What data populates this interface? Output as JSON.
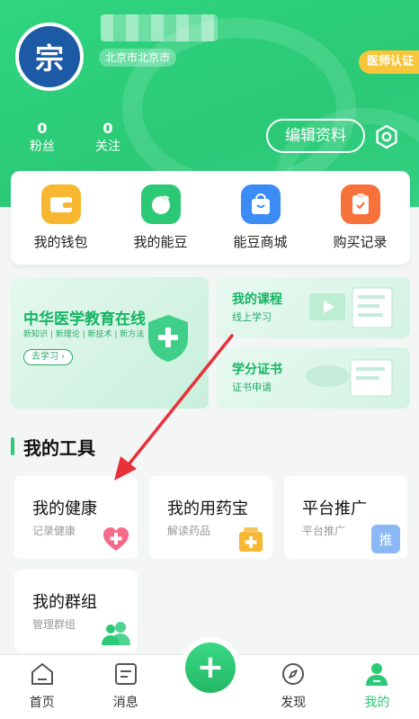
{
  "profile": {
    "location": "北京市北京市",
    "cert_badge": "医师认证",
    "avatar_glyph": "宗",
    "fans_count": "0",
    "fans_label": "粉丝",
    "follow_count": "0",
    "follow_label": "关注",
    "edit_label": "编辑资料"
  },
  "wallet": [
    {
      "label": "我的钱包",
      "icon": "wallet-icon",
      "color": "#f7b731"
    },
    {
      "label": "我的能豆",
      "icon": "bean-icon",
      "color": "#2bc976"
    },
    {
      "label": "能豆商城",
      "icon": "shopping-bag-icon",
      "color": "#3b8cf5"
    },
    {
      "label": "购买记录",
      "icon": "clipboard-icon",
      "color": "#f7723b"
    }
  ],
  "banners": {
    "big": {
      "title": "中华医学教育在线",
      "subtitle": "新知识 | 新理论 | 新技术 | 新方法",
      "button": "去学习 ›"
    },
    "course": {
      "title": "我的课程",
      "subtitle": "线上学习"
    },
    "credit": {
      "title": "学分证书",
      "subtitle": "证书申请"
    }
  },
  "tools": {
    "section_title": "我的工具",
    "items": [
      {
        "title": "我的健康",
        "subtitle": "记录健康",
        "icon": "heart-plus-icon"
      },
      {
        "title": "我的用药宝",
        "subtitle": "解读药品",
        "icon": "medicine-box-icon"
      },
      {
        "title": "平台推广",
        "subtitle": "平台推广",
        "icon": "promote-icon",
        "icon_text": "推"
      },
      {
        "title": "我的群组",
        "subtitle": "管理群组",
        "icon": "group-icon"
      }
    ]
  },
  "tabbar": {
    "items": [
      {
        "label": "首页",
        "icon": "home-icon"
      },
      {
        "label": "消息",
        "icon": "message-icon"
      },
      {
        "label": "发现",
        "icon": "compass-icon"
      },
      {
        "label": "我的",
        "icon": "profile-icon",
        "active": true
      }
    ],
    "fab_glyph": "+"
  },
  "colors": {
    "brand": "#2bc976",
    "accent_badge": "#f8c63b",
    "arrow": "#e8303a"
  }
}
